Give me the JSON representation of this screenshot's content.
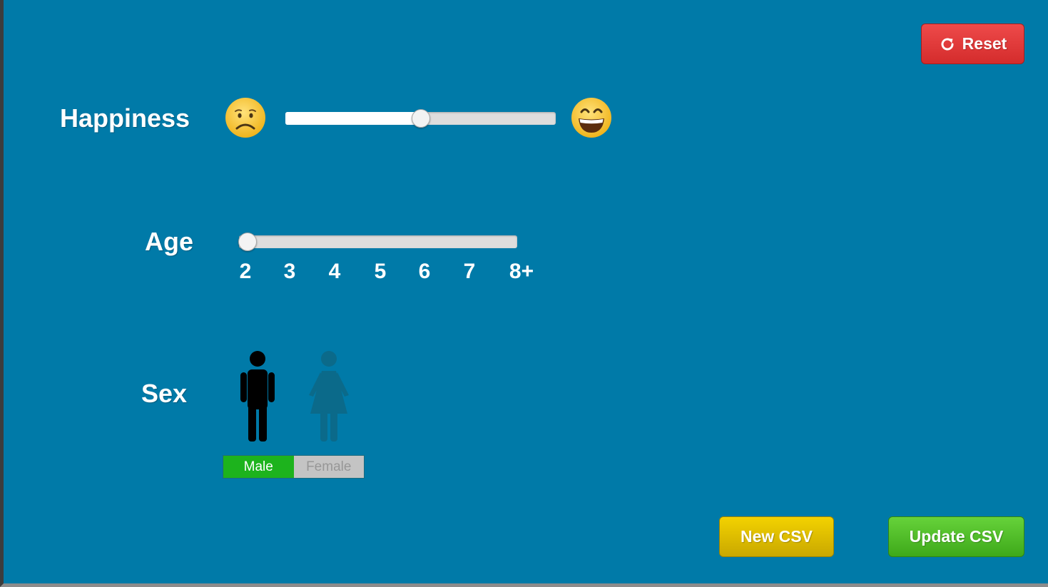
{
  "reset_button": {
    "label": "Reset",
    "icon": "refresh-icon",
    "color": "#e03b3b"
  },
  "happiness": {
    "label": "Happiness",
    "low_icon": "sad-face-icon",
    "high_icon": "grinning-face-icon",
    "value_fraction": 0.5
  },
  "age": {
    "label": "Age",
    "ticks": [
      "2",
      "3",
      "4",
      "5",
      "6",
      "7",
      "8+"
    ],
    "value_fraction": 0.0
  },
  "sex": {
    "label": "Sex",
    "male_icon": "male-figure-icon",
    "female_icon": "female-figure-icon",
    "options": [
      "Male",
      "Female"
    ],
    "selected": "Male",
    "selected_color": "#1db31d"
  },
  "buttons": {
    "new_csv": {
      "label": "New CSV",
      "color": "#e6c400"
    },
    "update_csv": {
      "label": "Update CSV",
      "color": "#52bf2a"
    }
  },
  "background_color": "#007aa8"
}
